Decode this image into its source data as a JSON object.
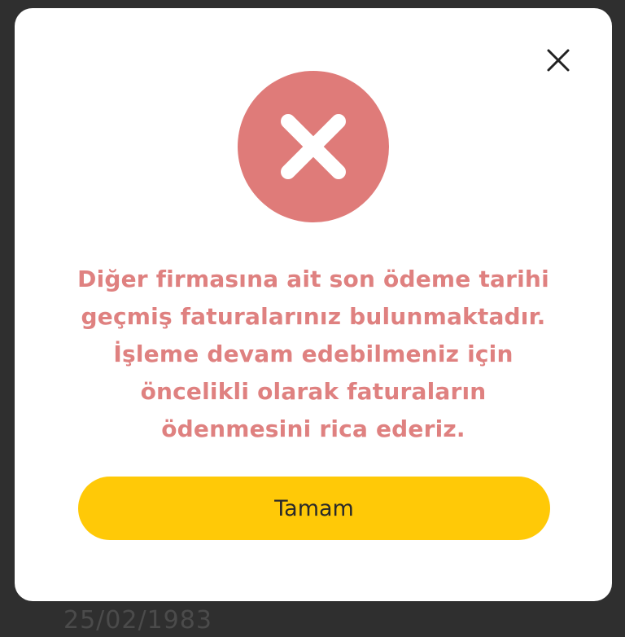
{
  "background": {
    "partial_text": "25/02/1983"
  },
  "dialog": {
    "close_icon": "close-icon",
    "status_icon": "error-x-icon",
    "message": "Diğer firmasına ait son ödeme tarihi geçmiş faturalarınız bulunmaktadır. İşleme devam edebilmeniz için öncelikli olarak faturaların ödenmesini rica ederiz.",
    "ok_label": "Tamam"
  },
  "colors": {
    "dialog_background": "#ffffff",
    "overlay": "#2f2f2f",
    "error_circle": "#df7b79",
    "message_text": "#df8180",
    "button": "#ffc907",
    "button_text": "#2a2a2a"
  }
}
